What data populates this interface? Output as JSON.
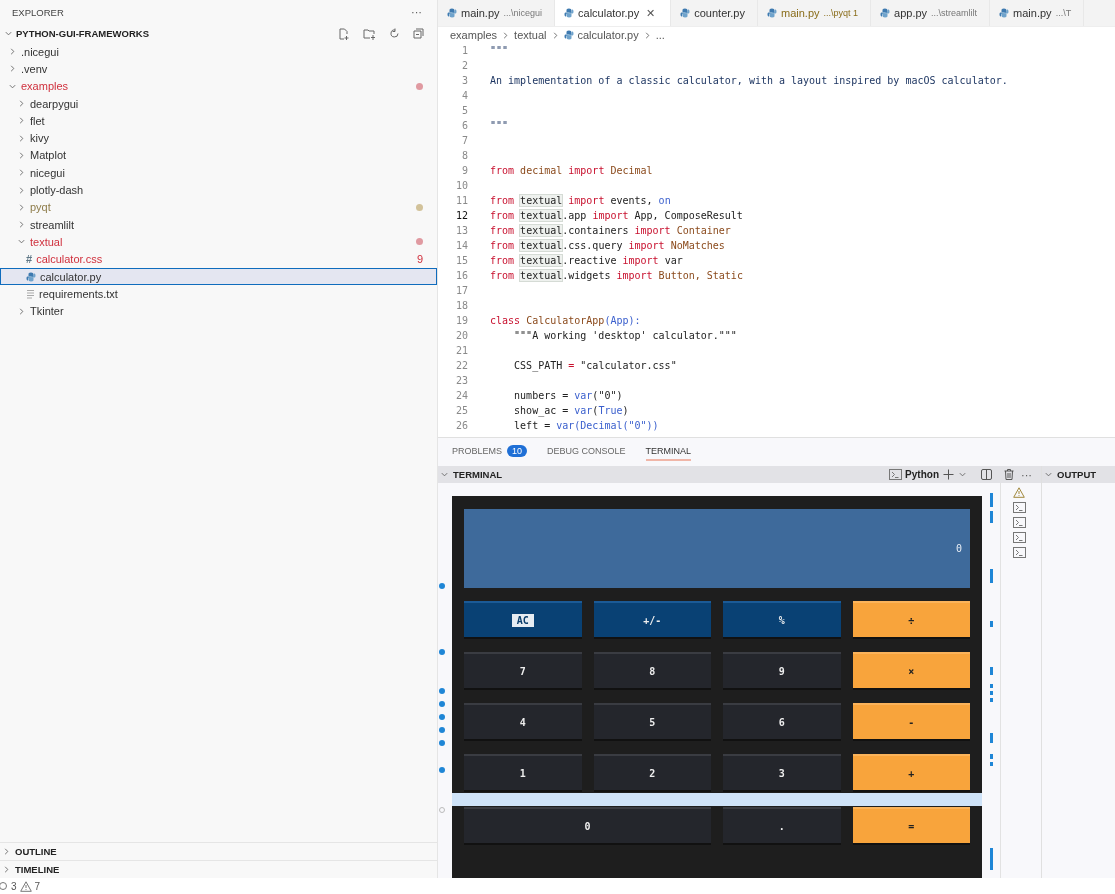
{
  "sidebar": {
    "title": "EXPLORER",
    "more": "···",
    "project": "PYTHON-GUI-FRAMEWORKS",
    "tree": [
      {
        "label": ".nicegui",
        "kind": "folder",
        "expanded": false,
        "selected": false,
        "has_errors": false,
        "has_warnings": false
      },
      {
        "label": ".venv",
        "kind": "folder",
        "expanded": false,
        "selected": false,
        "has_errors": false,
        "has_warnings": false
      },
      {
        "label": "examples",
        "kind": "folder",
        "expanded": true,
        "selected": false,
        "has_errors": true,
        "has_warnings": false,
        "color": "#e09aa1",
        "children": [
          {
            "label": "dearpygui",
            "kind": "folder",
            "expanded": false,
            "selected": false,
            "has_errors": false,
            "has_warnings": false
          },
          {
            "label": "flet",
            "kind": "folder",
            "expanded": false,
            "selected": false,
            "has_errors": false,
            "has_warnings": false
          },
          {
            "label": "kivy",
            "kind": "folder",
            "expanded": false,
            "selected": false,
            "has_errors": false,
            "has_warnings": false
          },
          {
            "label": "Matplot",
            "kind": "folder",
            "expanded": false,
            "selected": false,
            "has_errors": false,
            "has_warnings": false
          },
          {
            "label": "nicegui",
            "kind": "folder",
            "expanded": false,
            "selected": false,
            "has_errors": false,
            "has_warnings": false
          },
          {
            "label": "plotly-dash",
            "kind": "folder",
            "expanded": false,
            "selected": false,
            "has_errors": false,
            "has_warnings": false
          },
          {
            "label": "pyqt",
            "kind": "folder",
            "expanded": false,
            "selected": false,
            "has_errors": false,
            "has_warnings": true,
            "color": "#d2c29a"
          },
          {
            "label": "streamlilt",
            "kind": "folder",
            "expanded": false,
            "selected": false,
            "has_errors": false,
            "has_warnings": false
          },
          {
            "label": "textual",
            "kind": "folder",
            "expanded": true,
            "selected": false,
            "has_errors": true,
            "has_warnings": false,
            "color": "#e09aa1",
            "children": [
              {
                "label": "calculator.css",
                "kind": "css",
                "icon_text": "#",
                "selected": false,
                "has_errors": true,
                "has_warnings": false,
                "badge": "9"
              },
              {
                "label": "calculator.py",
                "kind": "python",
                "selected": true,
                "has_errors": false,
                "has_warnings": false
              },
              {
                "label": "requirements.txt",
                "kind": "text",
                "selected": false,
                "has_errors": false,
                "has_warnings": false
              }
            ]
          },
          {
            "label": "Tkinter",
            "kind": "folder",
            "expanded": false,
            "selected": false,
            "has_errors": false,
            "has_warnings": false
          }
        ]
      }
    ],
    "sections": [
      {
        "label": "OUTLINE",
        "expanded": false
      },
      {
        "label": "TIMELINE",
        "expanded": false
      }
    ]
  },
  "tabs": [
    {
      "label": "main.py",
      "description": "...\\nicegui",
      "selected": false,
      "has_warnings": false
    },
    {
      "label": "calculator.py",
      "close": "✕",
      "selected": true,
      "has_warnings": false
    },
    {
      "label": "counter.py",
      "selected": false,
      "has_warnings": false
    },
    {
      "label": "main.py",
      "description": "...\\pyqt 1",
      "selected": false,
      "has_warnings": true
    },
    {
      "label": "app.py",
      "description": "...\\streamlilt",
      "selected": false,
      "has_warnings": false
    },
    {
      "label": "main.py",
      "description": "...\\T",
      "selected": false,
      "has_warnings": false
    }
  ],
  "breadcrumbs": [
    "examples",
    "textual",
    "calculator.py",
    "..."
  ],
  "code": [
    {
      "number": "1",
      "current": false,
      "tokens": [
        {
          "kind": "doc",
          "text": "\"\"\""
        }
      ]
    },
    {
      "number": "2",
      "current": false
    },
    {
      "number": "3",
      "current": false,
      "tokens": [
        {
          "kind": "doc",
          "text": "An implementation of a classic calculator, with a layout inspired by macOS calculator."
        }
      ]
    },
    {
      "number": "4",
      "current": false
    },
    {
      "number": "5",
      "current": false
    },
    {
      "number": "6",
      "current": false,
      "tokens": [
        {
          "kind": "doc",
          "text": "\"\"\""
        }
      ]
    },
    {
      "number": "7",
      "current": false
    },
    {
      "number": "8",
      "current": false
    },
    {
      "number": "9",
      "current": false,
      "tokens": [
        {
          "kind": "keyword",
          "text": "from "
        },
        {
          "kind": "name",
          "text": "decimal "
        },
        {
          "kind": "keyword",
          "text": "import "
        },
        {
          "kind": "name",
          "text": "Decimal"
        }
      ]
    },
    {
      "number": "10",
      "current": false
    },
    {
      "number": "11",
      "current": false,
      "tokens": [
        {
          "kind": "keyword",
          "text": "from "
        },
        {
          "kind": "match",
          "text": "textual"
        },
        {
          "kind": "keyword",
          "text": " import"
        },
        {
          "kind": "plain",
          "text": " events, "
        },
        {
          "kind": "builtin",
          "text": "on"
        }
      ]
    },
    {
      "number": "12",
      "current": true,
      "tokens": [
        {
          "kind": "keyword",
          "text": "from "
        },
        {
          "kind": "match",
          "text": "textual"
        },
        {
          "kind": "plain",
          "text": ".app "
        },
        {
          "kind": "keyword",
          "text": "import"
        },
        {
          "kind": "plain",
          "text": " App, ComposeResult"
        }
      ]
    },
    {
      "number": "13",
      "current": false,
      "tokens": [
        {
          "kind": "keyword",
          "text": "from "
        },
        {
          "kind": "match",
          "text": "textual"
        },
        {
          "kind": "plain",
          "text": ".containers "
        },
        {
          "kind": "keyword",
          "text": "import "
        },
        {
          "kind": "name",
          "text": "Container"
        }
      ]
    },
    {
      "number": "14",
      "current": false,
      "tokens": [
        {
          "kind": "keyword",
          "text": "from "
        },
        {
          "kind": "match",
          "text": "textual"
        },
        {
          "kind": "plain",
          "text": ".css.query "
        },
        {
          "kind": "keyword",
          "text": "import "
        },
        {
          "kind": "name",
          "text": "NoMatches"
        }
      ]
    },
    {
      "number": "15",
      "current": false,
      "tokens": [
        {
          "kind": "keyword",
          "text": "from "
        },
        {
          "kind": "match",
          "text": "textual"
        },
        {
          "kind": "plain",
          "text": ".reactive "
        },
        {
          "kind": "keyword",
          "text": "import"
        },
        {
          "kind": "plain",
          "text": " var"
        }
      ]
    },
    {
      "number": "16",
      "current": false,
      "tokens": [
        {
          "kind": "keyword",
          "text": "from "
        },
        {
          "kind": "match",
          "text": "textual"
        },
        {
          "kind": "plain",
          "text": ".widgets "
        },
        {
          "kind": "keyword",
          "text": "import "
        },
        {
          "kind": "name",
          "text": "Button, Static"
        }
      ]
    },
    {
      "number": "17",
      "current": false
    },
    {
      "number": "18",
      "current": false
    },
    {
      "number": "19",
      "current": false,
      "tokens": [
        {
          "kind": "keyword",
          "text": "class "
        },
        {
          "kind": "name",
          "text": "CalculatorApp"
        },
        {
          "kind": "builtin",
          "text": "(App):"
        }
      ]
    },
    {
      "number": "20",
      "current": false,
      "tokens": [
        {
          "kind": "plain",
          "text": "    \"\"\"A working 'desktop' calculator.\"\"\""
        }
      ]
    },
    {
      "number": "21",
      "current": false
    },
    {
      "number": "22",
      "current": false,
      "tokens": [
        {
          "kind": "plain",
          "text": "    CSS_PATH "
        },
        {
          "kind": "keyword",
          "text": "="
        },
        {
          "kind": "plain",
          "text": " \"calculator.css\""
        }
      ]
    },
    {
      "number": "23",
      "current": false
    },
    {
      "number": "24",
      "current": false,
      "tokens": [
        {
          "kind": "plain",
          "text": "    numbers = "
        },
        {
          "kind": "builtin",
          "text": "var"
        },
        {
          "kind": "plain",
          "text": "(\"0\")"
        }
      ]
    },
    {
      "number": "25",
      "current": false,
      "tokens": [
        {
          "kind": "plain",
          "text": "    show_ac = "
        },
        {
          "kind": "builtin",
          "text": "var"
        },
        {
          "kind": "plain",
          "text": "("
        },
        {
          "kind": "builtin",
          "text": "True"
        },
        {
          "kind": "plain",
          "text": ")"
        }
      ]
    },
    {
      "number": "26",
      "current": false,
      "tokens": [
        {
          "kind": "plain",
          "text": "    left = "
        },
        {
          "kind": "builtin",
          "text": "var(Decimal(\"0\"))"
        }
      ]
    }
  ],
  "panel_tabs": [
    {
      "label": "PROBLEMS",
      "badge": "10",
      "selected": false
    },
    {
      "label": "DEBUG CONSOLE",
      "selected": false
    },
    {
      "label": "TERMINAL",
      "selected": true
    }
  ],
  "terminal": {
    "title": "TERMINAL",
    "shell": "Python",
    "more": "···",
    "calculator": {
      "display": "0",
      "rows": [
        [
          {
            "label": "AC",
            "kind": "function",
            "focused": true
          },
          {
            "label": "+/-",
            "kind": "function",
            "focused": false
          },
          {
            "label": "%",
            "kind": "function",
            "focused": false
          },
          {
            "label": "÷",
            "kind": "operator",
            "focused": false
          }
        ],
        [
          {
            "label": "7",
            "kind": "digit",
            "focused": false
          },
          {
            "label": "8",
            "kind": "digit",
            "focused": false
          },
          {
            "label": "9",
            "kind": "digit",
            "focused": false
          },
          {
            "label": "×",
            "kind": "operator",
            "focused": false
          }
        ],
        [
          {
            "label": "4",
            "kind": "digit",
            "focused": false
          },
          {
            "label": "5",
            "kind": "digit",
            "focused": false
          },
          {
            "label": "6",
            "kind": "digit",
            "focused": false
          },
          {
            "label": "-",
            "kind": "operator",
            "focused": false
          }
        ],
        [
          {
            "label": "1",
            "kind": "digit",
            "focused": false
          },
          {
            "label": "2",
            "kind": "digit",
            "focused": false
          },
          {
            "label": "3",
            "kind": "digit",
            "focused": false
          },
          {
            "label": "+",
            "kind": "operator",
            "focused": false
          }
        ],
        [
          {
            "label": "0",
            "kind": "digit",
            "colspan": 2,
            "focused": false
          },
          {
            "label": ".",
            "kind": "digit",
            "focused": false
          },
          {
            "label": "=",
            "kind": "operator",
            "focused": false
          }
        ]
      ]
    },
    "sessions": [
      {
        "kind": "warning"
      },
      {
        "kind": "shell"
      },
      {
        "kind": "shell"
      },
      {
        "kind": "shell"
      },
      {
        "kind": "shell"
      }
    ]
  },
  "output": {
    "title": "OUTPUT"
  },
  "status_bar": {
    "errors": "3",
    "warnings": "7"
  }
}
